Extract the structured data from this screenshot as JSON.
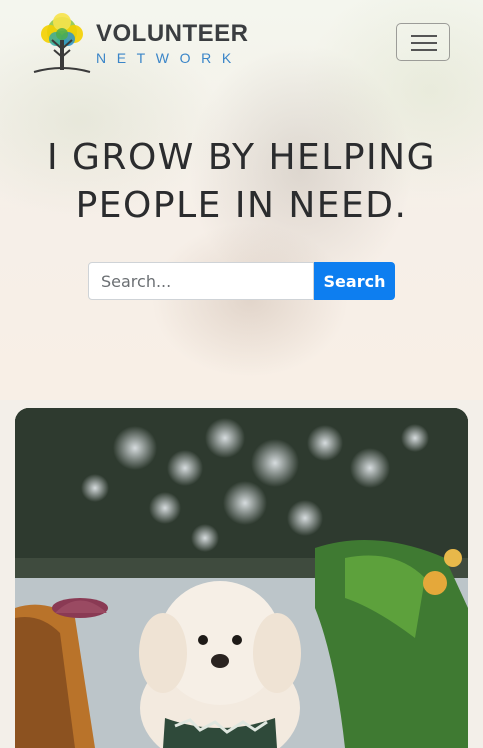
{
  "brand": {
    "name": "VOLUNTEER",
    "tagline": "NETWORK",
    "logo_icon": "tree-logo-icon"
  },
  "nav": {
    "menu_icon": "hamburger-menu-icon"
  },
  "hero": {
    "headline_line1": "I GROW BY HELPING",
    "headline_line2": "PEOPLE IN NEED."
  },
  "search": {
    "placeholder": "Search...",
    "value": "",
    "button_label": "Search"
  },
  "colors": {
    "primary": "#0d7ef0",
    "brand_text": "#3a3d40",
    "brand_accent": "#3a85c8"
  }
}
